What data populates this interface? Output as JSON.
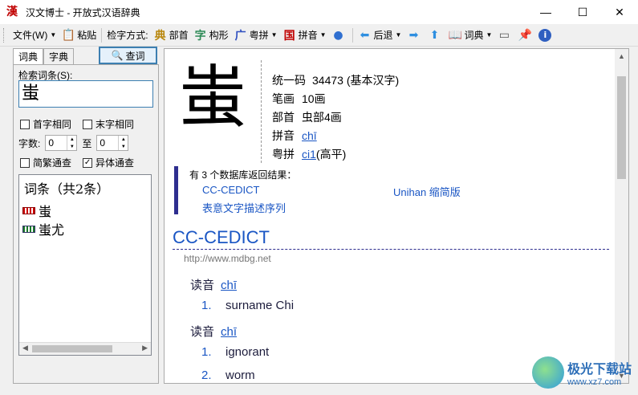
{
  "window": {
    "app_icon": "漢",
    "title": "汉文博士 - 开放式汉语辞典",
    "minimize": "—",
    "maximize": "☐",
    "close": "✕"
  },
  "toolbar": {
    "file": "文件(W)",
    "paste": "粘贴",
    "mode_label": "检字方式:",
    "radical_icon": "典",
    "radical": "部首",
    "shape_icon": "字",
    "shape": "构形",
    "cantonese_icon": "广",
    "cantonese": "粤拼",
    "pinyin_icon": "国",
    "pinyin": "拼音",
    "back": "后退",
    "dict": "词典"
  },
  "left": {
    "tab_words": "词典",
    "tab_chars": "字典",
    "query_btn": "查词",
    "search_label": "检索词条(S):",
    "search_value": "蚩",
    "cb_first": "首字相同",
    "cb_last": "末字相同",
    "count_label": "字数:",
    "count_from": "0",
    "count_to_label": "至",
    "count_to": "0",
    "cb_trad": "简繁通查",
    "cb_variant": "异体通查",
    "results_header": "词条（共2条）",
    "results": [
      "蚩",
      "蚩尤"
    ]
  },
  "right": {
    "char": "蚩",
    "info": {
      "code_label": "统一码",
      "code_value": "34473 (基本汉字)",
      "strokes_label": "笔画",
      "strokes_value": "10画",
      "radical_label": "部首",
      "radical_value": "虫部4画",
      "pinyin_label": "拼音",
      "pinyin_value": "chī",
      "jyutping_label": "粤拼",
      "jyutping_value": "ci1",
      "jyutping_tone": "(高平)"
    },
    "db_title": "有 3 个数据库返回结果：",
    "db_links": [
      "CC-CEDICT",
      "Unihan 缩简版",
      "表意文字描述序列"
    ],
    "section_title": "CC-CEDICT",
    "section_url": "http://www.mdbg.net",
    "reading_label": "读音",
    "reading_1": "chī",
    "def_1": "surname Chi",
    "reading_2": "chī",
    "def_2": "ignorant",
    "def_3": "worm",
    "num_1": "1.",
    "num_2": "1.",
    "num_3": "2."
  },
  "watermark": {
    "title": "极光下载站",
    "url": "www.xz7.com"
  }
}
